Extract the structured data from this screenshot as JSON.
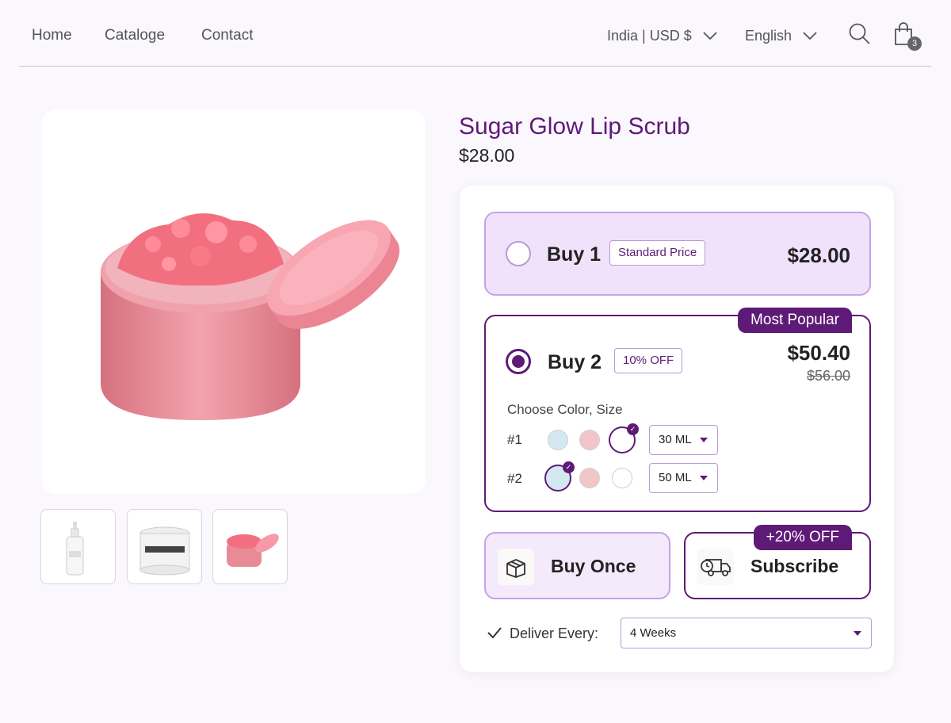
{
  "nav": {
    "links": [
      "Home",
      "Cataloge",
      "Contact"
    ],
    "region": "India | USD $",
    "language": "English",
    "cart_count": "3"
  },
  "product": {
    "title": "Sugar Glow Lip Scrub",
    "price": "$28.00"
  },
  "offers": {
    "buy1": {
      "label": "Buy 1",
      "tag": "Standard Price",
      "price": "$28.00",
      "selected": false
    },
    "buy2": {
      "label": "Buy 2",
      "tag": "10% OFF",
      "ribbon": "Most Popular",
      "price": "$50.40",
      "old_price": "$56.00",
      "selected": true,
      "choose_label": "Choose Color, Size",
      "items": [
        {
          "label": "#1",
          "size": "30 ML",
          "selected_swatch": 2
        },
        {
          "label": "#2",
          "size": "50 ML",
          "selected_swatch": 0
        }
      ],
      "swatch_colors": [
        "#d3e8ef",
        "#f0c6c9",
        "#ffffff"
      ]
    }
  },
  "purchase": {
    "once_label": "Buy Once",
    "subscribe_label": "Subscribe",
    "subscribe_ribbon": "+20% OFF",
    "deliver_label": "Deliver Every:",
    "deliver_value": "4 Weeks"
  },
  "colors": {
    "brand": "#5e1a77",
    "light_purple": "#f1e2fc",
    "border_purple": "#c6a2e8"
  }
}
